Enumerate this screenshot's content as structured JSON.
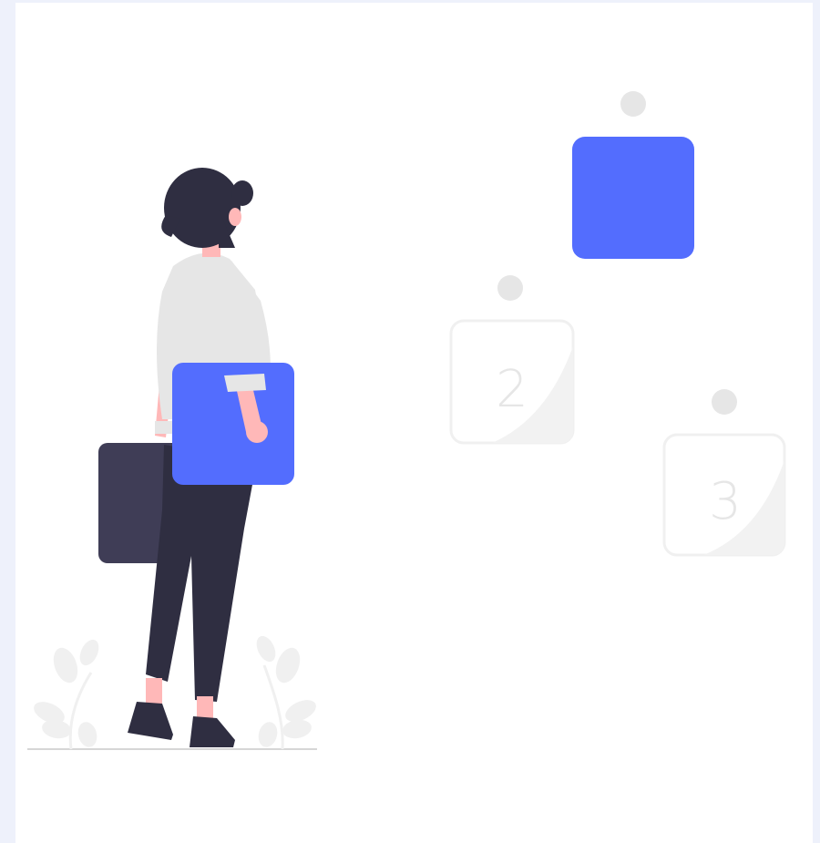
{
  "illustration": {
    "steps": [
      {
        "label": "",
        "state": "active"
      },
      {
        "label": "2",
        "state": "inactive"
      },
      {
        "label": "3",
        "state": "inactive"
      }
    ],
    "colors": {
      "accent": "#536DFE",
      "pending_card": "#f2f2f2",
      "dot": "#e6e6e6",
      "foliage": "#f0f0f0",
      "hair_pants": "#2f2e41",
      "suitcase": "#3f3d56",
      "shirt": "#e6e6e6",
      "skin": "#ffb8b8",
      "page_background": "#eef1fb"
    }
  }
}
